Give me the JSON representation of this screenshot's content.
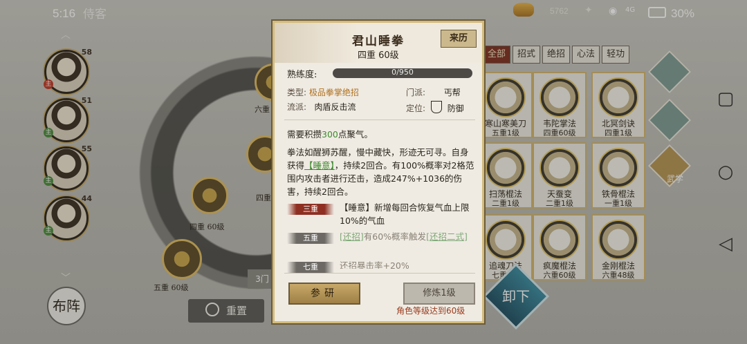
{
  "status_bar": {
    "time": "5:16",
    "screen_title": "侍客",
    "currency": "5762",
    "battery": "30%",
    "signal": "4G"
  },
  "left_panel": {
    "characters": [
      {
        "level": "58",
        "tag": "主"
      },
      {
        "level": "51",
        "tag": "主"
      },
      {
        "level": "55",
        "tag": "主"
      },
      {
        "level": "44",
        "tag": "主"
      }
    ],
    "nodes": [
      {
        "label": "六重"
      },
      {
        "label": "四重"
      },
      {
        "label": "四重 60级"
      },
      {
        "label": "五重 60级"
      }
    ],
    "formation_label": "布阵",
    "reset_label": "重置",
    "count_label": "3门"
  },
  "right_panel": {
    "tabs": [
      "全部",
      "招式",
      "绝招",
      "心法",
      "轻功"
    ],
    "side_tabs": [
      "武学"
    ],
    "cards": [
      {
        "name": "寒山寒美刀",
        "level": "五重1级"
      },
      {
        "name": "韦陀掌法",
        "level": "四重60级"
      },
      {
        "name": "北冥剑诀",
        "level": "四重1级"
      },
      {
        "name": "扫荡棍法",
        "level": "二重1级"
      },
      {
        "name": "天蚕变",
        "level": "二重1级"
      },
      {
        "name": "铁骨棍法",
        "level": "一重1级"
      },
      {
        "name": "追魂刀法",
        "level": "七重1级"
      },
      {
        "name": "疯魔棍法",
        "level": "六重60级"
      },
      {
        "name": "金刚棍法",
        "level": "六重48级"
      }
    ],
    "unequip_label": "卸下"
  },
  "popup": {
    "title": "君山睡拳",
    "subtitle": "四重 60级",
    "origin_button": "来历",
    "proficiency_label": "熟练度:",
    "proficiency_text": "0/950",
    "proficiency_ratio": 0,
    "type_label": "类型:",
    "type_value": "极品拳掌绝招",
    "school_label": "门派:",
    "school_value": "丐帮",
    "style_label": "流派:",
    "style_value": "肉盾反击流",
    "position_label": "定位:",
    "position_value": "防御",
    "energy_pre": "需要积攒",
    "energy_num": "300",
    "energy_post": "点聚气。",
    "desc_a": "拳法如醒狮苏醒，慢中藏快，形迹无可寻。自身获得",
    "desc_link": "【睡意】",
    "desc_b": "，持续2回合。有100%概率对2格范围内攻击者进行还击，造成247%+1036的伤害，持续2回合。",
    "tier3_label": "三重",
    "tier3_text": "【睡意】新增每回合恢复气血上限10%的气血",
    "tier5_label": "五重",
    "tier5_link1": "[还招]",
    "tier5_mid": "有60%概率触发",
    "tier5_link2": "[还招二式]",
    "tier7_label": "七重",
    "tier7_text": "还招暴击率+20%",
    "study_button": "参研",
    "train_button": "修炼1级",
    "requirement": "角色等级达到60级"
  }
}
